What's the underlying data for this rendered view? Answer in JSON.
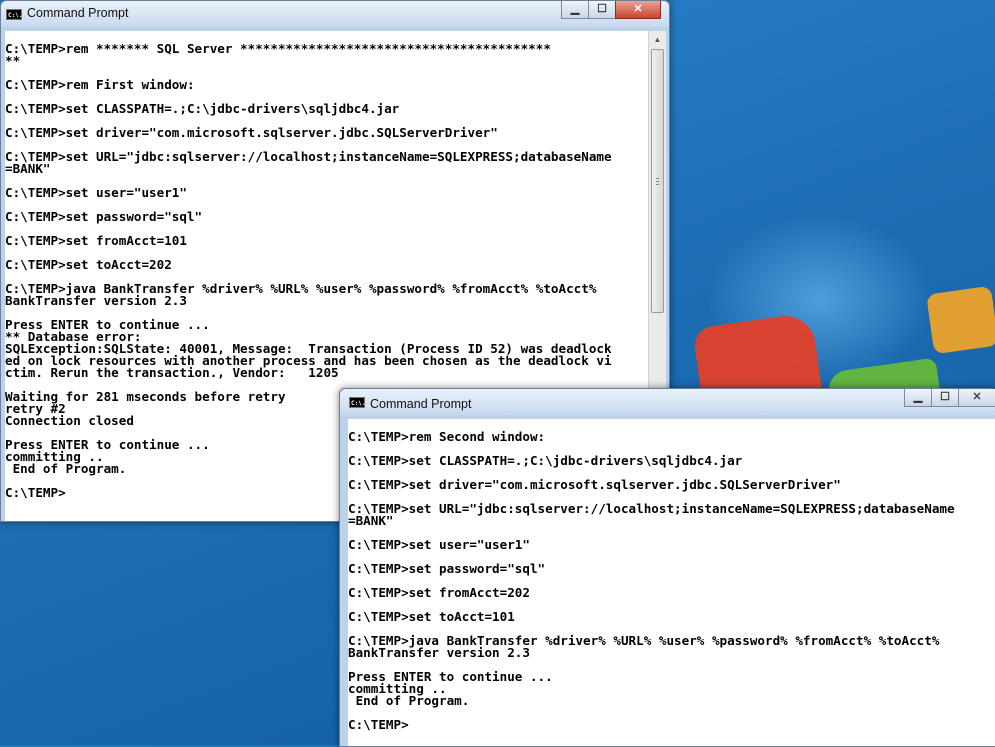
{
  "window1": {
    "title": "Command Prompt",
    "icon_label": "C:\\.",
    "lines": [
      "C:\\TEMP>rem ******* SQL Server *****************************************",
      "**",
      "",
      "C:\\TEMP>rem First window:",
      "",
      "C:\\TEMP>set CLASSPATH=.;C:\\jdbc-drivers\\sqljdbc4.jar",
      "",
      "C:\\TEMP>set driver=\"com.microsoft.sqlserver.jdbc.SQLServerDriver\"",
      "",
      "C:\\TEMP>set URL=\"jdbc:sqlserver://localhost;instanceName=SQLEXPRESS;databaseName",
      "=BANK\"",
      "",
      "C:\\TEMP>set user=\"user1\"",
      "",
      "C:\\TEMP>set password=\"sql\"",
      "",
      "C:\\TEMP>set fromAcct=101",
      "",
      "C:\\TEMP>set toAcct=202",
      "",
      "C:\\TEMP>java BankTransfer %driver% %URL% %user% %password% %fromAcct% %toAcct%",
      "BankTransfer version 2.3",
      "",
      "Press ENTER to continue ...",
      "** Database error:",
      "SQLException:SQLState: 40001, Message:  Transaction (Process ID 52) was deadlock",
      "ed on lock resources with another process and has been chosen as the deadlock vi",
      "ctim. Rerun the transaction., Vendor:   1205",
      "",
      "Waiting for 281 mseconds before retry",
      "retry #2",
      "Connection closed",
      "",
      "Press ENTER to continue ...",
      "committing ..",
      " End of Program.",
      "",
      "C:\\TEMP>"
    ]
  },
  "window2": {
    "title": "Command Prompt",
    "icon_label": "C:\\.",
    "lines": [
      "C:\\TEMP>rem Second window:",
      "",
      "C:\\TEMP>set CLASSPATH=.;C:\\jdbc-drivers\\sqljdbc4.jar",
      "",
      "C:\\TEMP>set driver=\"com.microsoft.sqlserver.jdbc.SQLServerDriver\"",
      "",
      "C:\\TEMP>set URL=\"jdbc:sqlserver://localhost;instanceName=SQLEXPRESS;databaseName",
      "=BANK\"",
      "",
      "C:\\TEMP>set user=\"user1\"",
      "",
      "C:\\TEMP>set password=\"sql\"",
      "",
      "C:\\TEMP>set fromAcct=202",
      "",
      "C:\\TEMP>set toAcct=101",
      "",
      "C:\\TEMP>java BankTransfer %driver% %URL% %user% %password% %fromAcct% %toAcct%",
      "BankTransfer version 2.3",
      "",
      "Press ENTER to continue ...",
      "committing ..",
      " End of Program.",
      "",
      "C:\\TEMP>"
    ]
  },
  "controls": {
    "minimize": "▁",
    "maximize": "☐",
    "close": "✕"
  }
}
